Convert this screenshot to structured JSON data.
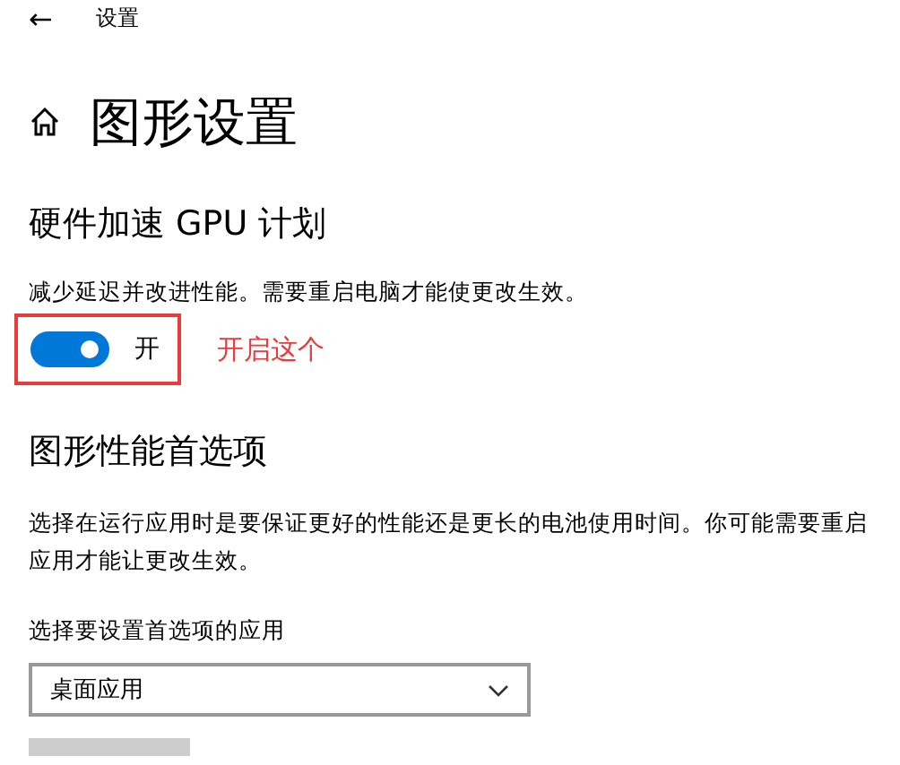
{
  "header": {
    "back": "←",
    "title": "设置"
  },
  "page_title": "图形设置",
  "gpu_section": {
    "heading": "硬件加速 GPU 计划",
    "description": "减少延迟并改进性能。需要重启电脑才能使更改生效。",
    "toggle": {
      "on": true,
      "label": "开"
    },
    "annotation": {
      "text": "开启这个",
      "color": "#e83b3b"
    }
  },
  "preference_section": {
    "heading": "图形性能首选项",
    "description": "选择在运行应用时是要保证更好的性能还是更长的电池使用时间。你可能需要重启应用才能让更改生效。",
    "select_label": "选择要设置首选项的应用",
    "select": {
      "value": "桌面应用"
    }
  }
}
